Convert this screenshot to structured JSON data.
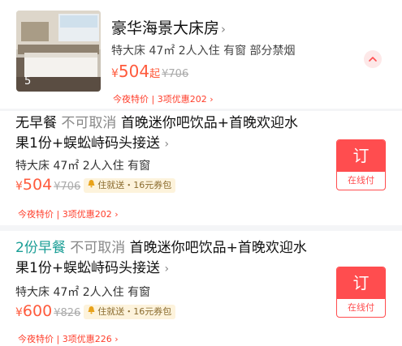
{
  "room": {
    "photo_count": "5",
    "title": "豪华海景大床房",
    "title_chevron": "›",
    "subtitle": "特大床 47㎡ 2人入住 有窗 部分禁烟",
    "currency": "¥",
    "price": "504",
    "price_suffix": "起",
    "original_price": "¥706",
    "tonight_label": "今夜特价",
    "offers_label": "3项优惠202",
    "offers_chevron": "›"
  },
  "plans": [
    {
      "breakfast": "无早餐",
      "cancel": "不可取消",
      "perks": "首晚迷你吧饮品+首晚欢迎水果1份+蜈蚣峙码头接送",
      "chevron": "›",
      "details": "特大床 47㎡ 2人入住 有窗",
      "currency": "¥",
      "price": "504",
      "original_price": "¥706",
      "promo": "住就送・16元券包",
      "tonight_label": "今夜特价",
      "offers_label": "3项优惠202",
      "offers_chevron": "›",
      "book_label": "订",
      "pay_label": "在线付"
    },
    {
      "breakfast": "2份早餐",
      "cancel": "不可取消",
      "perks": "首晚迷你吧饮品+首晚欢迎水果1份+蜈蚣峙码头接送",
      "chevron": "›",
      "details": "特大床 47㎡ 2人入住 有窗",
      "currency": "¥",
      "price": "600",
      "original_price": "¥826",
      "promo": "住就送・16元券包",
      "tonight_label": "今夜特价",
      "offers_label": "3项优惠226",
      "offers_chevron": "›",
      "book_label": "订",
      "pay_label": "在线付"
    }
  ],
  "colors": {
    "price": "#ff5a3c",
    "accent_red": "#ff4d4f",
    "breakfast_teal": "#1a9e96",
    "promo_bg": "#fdf3dc"
  },
  "icons": {
    "collapse": "chevron-up-icon",
    "promo": "bell-icon"
  }
}
